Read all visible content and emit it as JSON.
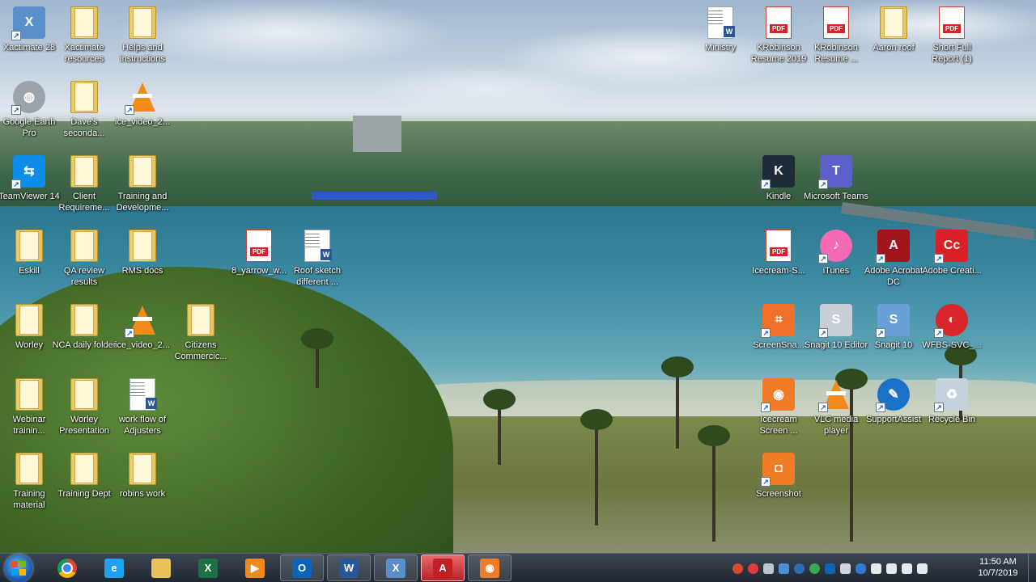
{
  "desktop": {
    "left_icons": [
      {
        "label": "Xactimate 28",
        "icon": "xactimate-icon"
      },
      {
        "label": "Xactimate resources",
        "icon": "folder-icon"
      },
      {
        "label": "Helps and instructions",
        "icon": "folder-icon"
      },
      {
        "label": "Google Earth Pro",
        "icon": "google-earth-icon"
      },
      {
        "label": "Dave's seconda...",
        "icon": "folder-icon"
      },
      {
        "label": "ice_video_2...",
        "icon": "vlc-icon"
      },
      {
        "label": "TeamViewer 14",
        "icon": "teamviewer-icon"
      },
      {
        "label": "Client Requireme...",
        "icon": "folder-icon"
      },
      {
        "label": "Training and Developme...",
        "icon": "folder-icon"
      },
      {
        "label": "Eskill",
        "icon": "folder-icon"
      },
      {
        "label": "QA review results",
        "icon": "folder-icon"
      },
      {
        "label": "RMS docs",
        "icon": "folder-icon"
      },
      {
        "label": "8_yarrow_w...",
        "icon": "pdf-icon"
      },
      {
        "label": "Roof sketch different ...",
        "icon": "word-doc-icon"
      },
      {
        "label": "Worley",
        "icon": "folder-icon"
      },
      {
        "label": "NCA daily folder",
        "icon": "folder-icon"
      },
      {
        "label": "ice_video_2...",
        "icon": "vlc-icon"
      },
      {
        "label": "Citizens Commercic...",
        "icon": "folder-icon"
      },
      {
        "label": "Webinar trainin...",
        "icon": "folder-icon"
      },
      {
        "label": "Worley Presentation",
        "icon": "folder-icon"
      },
      {
        "label": "work flow of Adjusters",
        "icon": "word-doc-icon"
      },
      {
        "label": "Training material",
        "icon": "folder-icon"
      },
      {
        "label": "Training Dept",
        "icon": "folder-icon"
      },
      {
        "label": "robins work",
        "icon": "folder-icon"
      }
    ],
    "right_icons": [
      {
        "label": "Ministry",
        "icon": "word-doc-icon"
      },
      {
        "label": "KRobinson Resume 2019",
        "icon": "pdf-icon"
      },
      {
        "label": "KRobinson Resume ...",
        "icon": "pdf-icon"
      },
      {
        "label": "Aaron roof",
        "icon": "folder-icon"
      },
      {
        "label": "Short Full Report (1)",
        "icon": "pdf-icon"
      },
      {
        "label": "Kindle",
        "icon": "kindle-icon"
      },
      {
        "label": "Microsoft Teams",
        "icon": "teams-icon"
      },
      {
        "label": "Icecream-S...",
        "icon": "pdf-icon"
      },
      {
        "label": "iTunes",
        "icon": "itunes-icon"
      },
      {
        "label": "Adobe Acrobat DC",
        "icon": "acrobat-icon"
      },
      {
        "label": "Adobe Creati...",
        "icon": "creative-cloud-icon"
      },
      {
        "label": "ScreenSna...",
        "icon": "screensnap-icon"
      },
      {
        "label": "Snagit 10 Editor",
        "icon": "snagit-editor-icon"
      },
      {
        "label": "Snagit 10",
        "icon": "snagit-icon"
      },
      {
        "label": "WFBS-SVC_...",
        "icon": "wfbs-icon"
      },
      {
        "label": "Icecream Screen ...",
        "icon": "icecream-recorder-icon"
      },
      {
        "label": "VLC media player",
        "icon": "vlc-icon"
      },
      {
        "label": "SupportAssist",
        "icon": "supportassist-icon"
      },
      {
        "label": "Recycle Bin",
        "icon": "recycle-bin-icon"
      },
      {
        "label": "Screenshot",
        "icon": "screenshot-icon"
      }
    ]
  },
  "taskbar": {
    "start_icon": "windows-start-icon",
    "pinned": [
      {
        "name": "chrome",
        "icon": "chrome-icon",
        "glyph": "",
        "color": "#db4437"
      },
      {
        "name": "internet-explorer",
        "icon": "ie-icon",
        "glyph": "e",
        "color": "#1ea1f1"
      },
      {
        "name": "file-explorer",
        "icon": "folder-icon",
        "glyph": "",
        "color": "#e8c15a"
      },
      {
        "name": "excel",
        "icon": "excel-icon",
        "glyph": "X",
        "color": "#1d7044"
      },
      {
        "name": "media-player",
        "icon": "media-player-icon",
        "glyph": "▶",
        "color": "#f08a1c"
      },
      {
        "name": "outlook",
        "icon": "outlook-icon",
        "glyph": "O",
        "color": "#0a64b8"
      },
      {
        "name": "word",
        "icon": "word-icon",
        "glyph": "W",
        "color": "#2b5797"
      },
      {
        "name": "xactimate",
        "icon": "xactimate-icon",
        "glyph": "X",
        "color": "#5b8fc9"
      },
      {
        "name": "acrobat",
        "icon": "acrobat-icon",
        "glyph": "A",
        "color": "#c41e25"
      },
      {
        "name": "icecream",
        "icon": "icecream-icon",
        "glyph": "◉",
        "color": "#f07c28"
      }
    ],
    "clock": {
      "time": "11:50 AM",
      "date": "10/7/2019"
    }
  }
}
